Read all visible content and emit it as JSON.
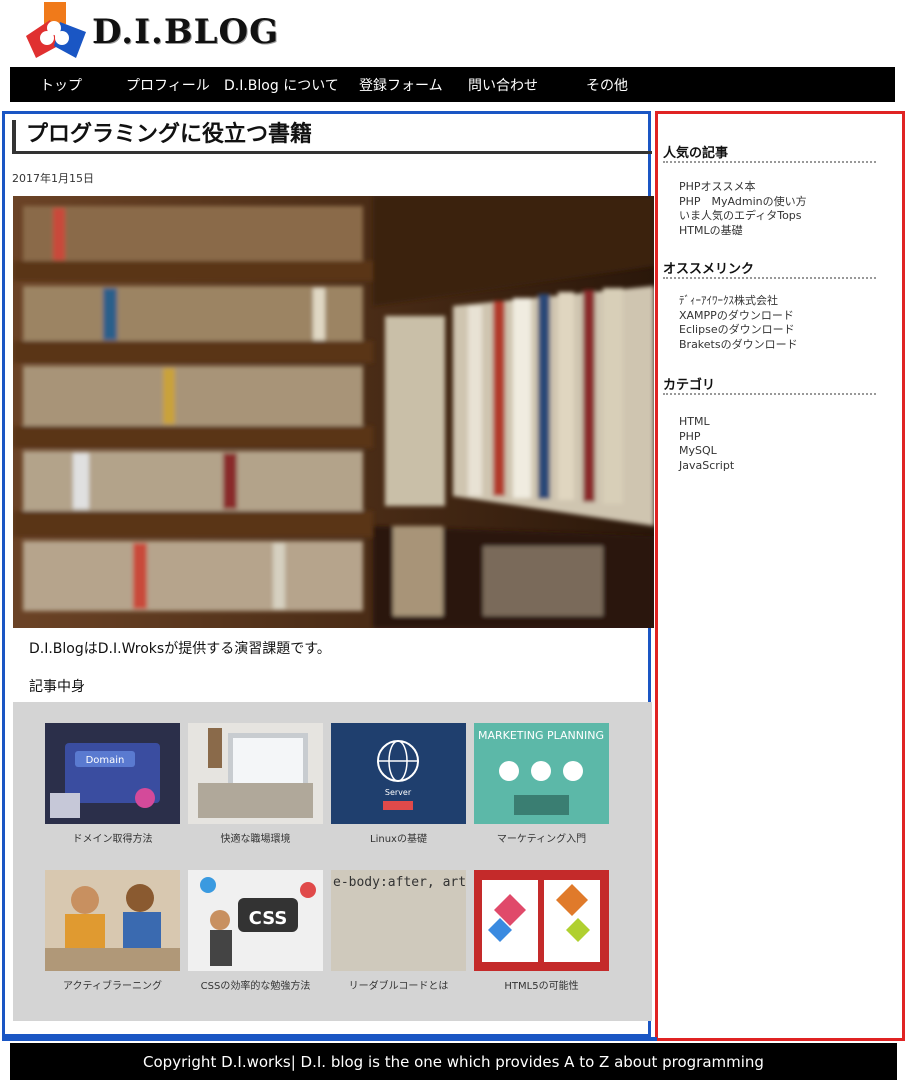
{
  "logo": {
    "text": "D.I.BLOG"
  },
  "nav": {
    "items": [
      "トップ",
      "プロフィール",
      "D.I.Blog について",
      "登録フォーム",
      "問い合わせ",
      "その他"
    ]
  },
  "post": {
    "title": "プログラミングに役立つ書籍",
    "date": "2017年1月15日",
    "intro": "D.I.BlogはD.I.Wroksが提供する演習課題です。",
    "body_label": "記事中身"
  },
  "gallery": {
    "items": [
      {
        "caption": "ドメイン取得方法",
        "thumb_text": "Domain"
      },
      {
        "caption": "快適な職場環境",
        "thumb_text": ""
      },
      {
        "caption": "Linuxの基礎",
        "thumb_text": "Server"
      },
      {
        "caption": "マーケティング入門",
        "thumb_text": "MARKETING PLANNING"
      },
      {
        "caption": "アクティブラーニング",
        "thumb_text": ""
      },
      {
        "caption": "CSSの効率的な勉強方法",
        "thumb_text": "CSS"
      },
      {
        "caption": "リーダブルコードとは",
        "thumb_text": "e-body:after, article-body-more, ack-form ul:after { content: '; display: block; clear: both;"
      },
      {
        "caption": "HTML5の可能性",
        "thumb_text": ""
      }
    ]
  },
  "sidebar": {
    "popular": {
      "title": "人気の記事",
      "items": [
        "PHPオススメ本",
        "PHP　MyAdminの使い方",
        "いま人気のエディタTops",
        "HTMLの基礎"
      ]
    },
    "links": {
      "title": "オススメリンク",
      "items": [
        "ﾃﾞｨｰｱｲﾜｰｸｽ株式会社",
        "XAMPPのダウンロード",
        "Eclipseのダウンロード",
        "Braketsのダウンロード"
      ]
    },
    "categories": {
      "title": "カテゴリ",
      "items": [
        "HTML",
        "PHP",
        "MySQL",
        "JavaScript"
      ]
    }
  },
  "footer": {
    "text": "Copyright D.I.works| D.I. blog is the one which provides A to Z about programming"
  },
  "colors": {
    "main_border": "#1a56c4",
    "sidebar_border": "#e02323",
    "nav_bg": "#000000"
  }
}
